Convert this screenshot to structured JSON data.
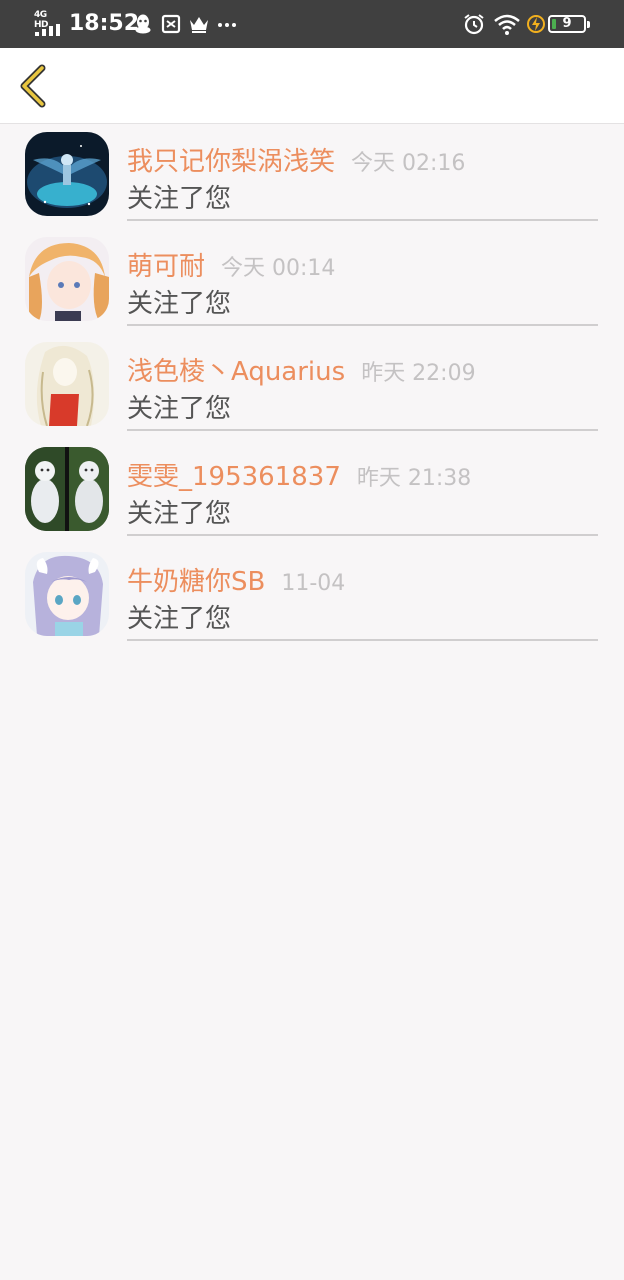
{
  "status_bar": {
    "network": "4G HD",
    "time": "18:52",
    "battery": "9",
    "icons": [
      "qq-icon",
      "screenshot-icon",
      "crown-icon",
      "more-dots-icon",
      "alarm-icon",
      "wifi-icon",
      "charging-icon",
      "battery-icon"
    ]
  },
  "toolbar": {
    "back_icon": "chevron-left-icon"
  },
  "notifications": [
    {
      "name": "我只记你梨涡浅笑",
      "time": "今天 02:16",
      "action": "关注了您"
    },
    {
      "name": "萌可耐",
      "time": "今天 00:14",
      "action": "关注了您"
    },
    {
      "name": "浅色棱丶Aquarius",
      "time": "昨天 22:09",
      "action": "关注了您"
    },
    {
      "name": "雯雯_195361837",
      "time": "昨天 21:38",
      "action": "关注了您"
    },
    {
      "name": "牛奶糖你SB",
      "time": "11-04",
      "action": "关注了您"
    }
  ],
  "colors": {
    "status_bar": "#404040",
    "nickname": "#ec8e5e",
    "time": "#c4c2c3",
    "back_arrow": "#e8c640",
    "background": "#f8f6f7"
  }
}
